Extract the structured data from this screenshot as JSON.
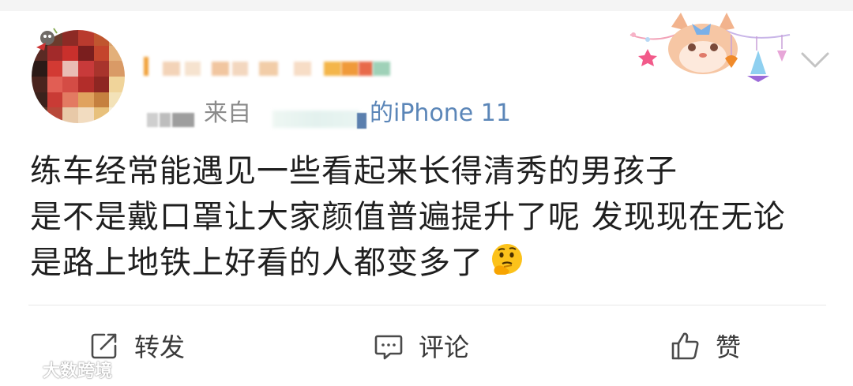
{
  "post": {
    "source_prefix": "来自",
    "source_suffix": "的iPhone 11",
    "text_lines": [
      "练车经常能遇见一些看起来长得清秀的男孩子",
      "是不是戴口罩让大家颜值普遍提升了呢 发现现在无论",
      "是路上地铁上好看的人都变多了"
    ],
    "emoji": "thinking-face-icon"
  },
  "actions": {
    "repost_label": "转发",
    "comment_label": "评论",
    "like_label": "赞"
  },
  "watermark": {
    "text": "大数跨境"
  },
  "colors": {
    "source_link": "#5b86b8",
    "meta_gray": "#8b8b8b",
    "body_text": "#1f1f1f"
  }
}
